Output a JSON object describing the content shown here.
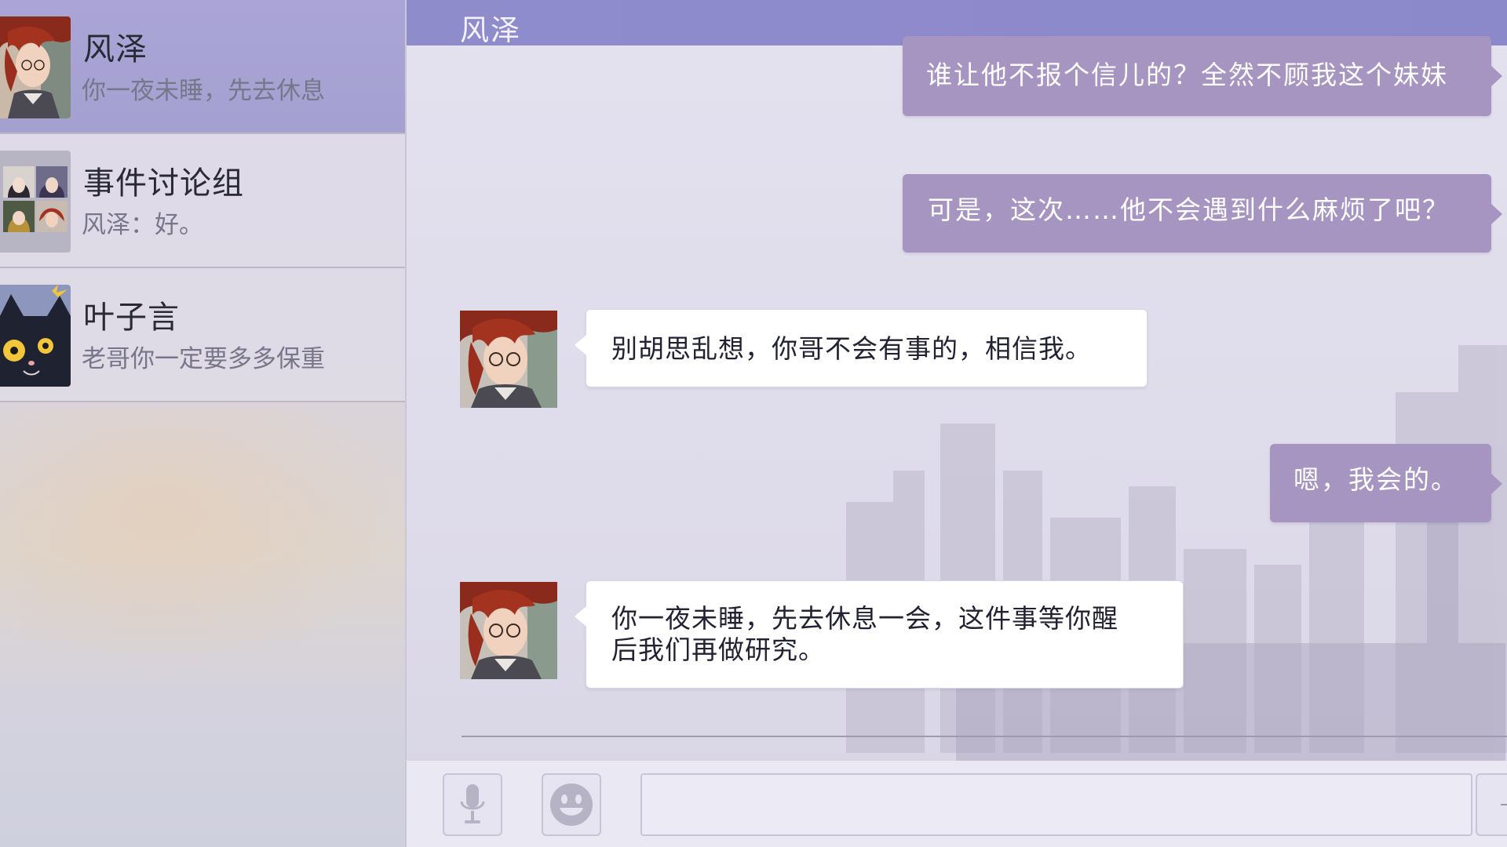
{
  "sidebar": {
    "contacts": [
      {
        "name": "风泽",
        "preview": "你一夜未睡，先去休息",
        "active": true
      },
      {
        "name": "事件讨论组",
        "preview": "风泽：好。",
        "active": false
      },
      {
        "name": "叶子言",
        "preview": "老哥你一定要多多保重",
        "active": false
      }
    ]
  },
  "chat": {
    "title": "风泽",
    "messages": [
      {
        "from": "me",
        "text": "谁让他不报个信儿的？全然不顾我这个妹妹"
      },
      {
        "from": "me",
        "text": "可是，这次……他不会遇到什么麻烦了吧？"
      },
      {
        "from": "风泽",
        "text": "别胡思乱想，你哥不会有事的，相信我。"
      },
      {
        "from": "me",
        "text": "嗯，我会的。"
      },
      {
        "from": "风泽",
        "lines": [
          "你一夜未睡，先去休息一会，这件事等你醒",
          "后我们再做研究。"
        ]
      }
    ]
  },
  "input_bar": {
    "mic_icon": "microphone-icon",
    "emoji_icon": "smiley-icon",
    "message_value": "",
    "send_icon": "send-icon"
  },
  "colors": {
    "header": "#8f8ccc",
    "active_contact": "#a9a4d5",
    "outgoing_bubble": "#a795c1",
    "incoming_bubble": "#ffffff"
  }
}
